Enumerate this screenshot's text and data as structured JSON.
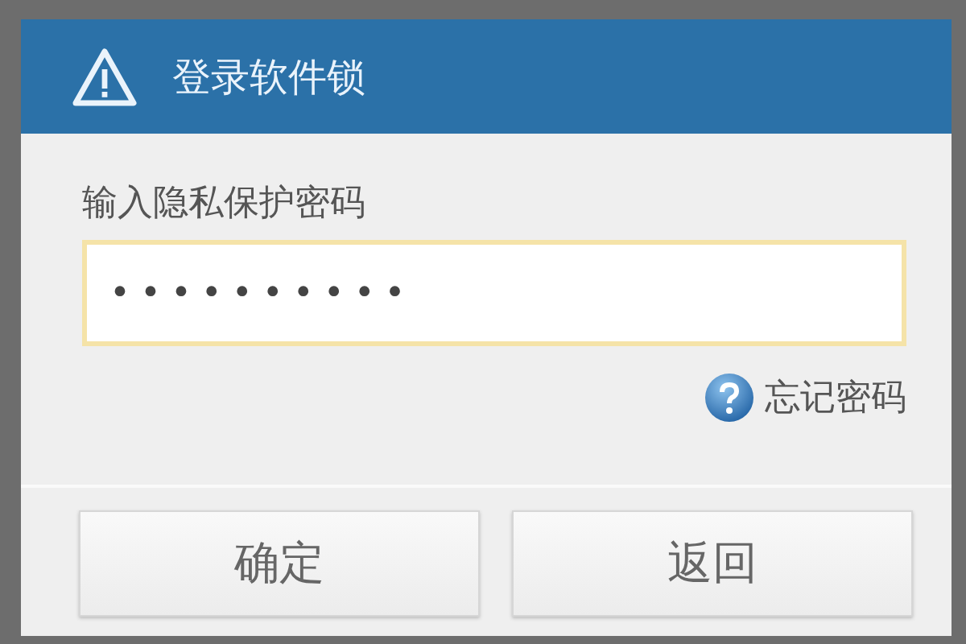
{
  "dialog": {
    "title": "登录软件锁",
    "field_label": "输入隐私保护密码",
    "password": {
      "value": "••••••••••",
      "focused": true
    },
    "forgot_link": "忘记密码",
    "buttons": [
      {
        "label": "确定"
      },
      {
        "label": "返回"
      }
    ]
  }
}
